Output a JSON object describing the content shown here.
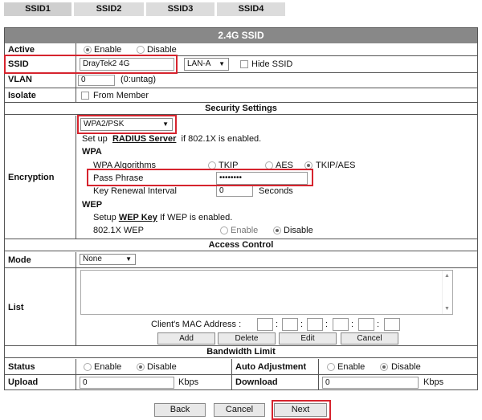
{
  "tabs": [
    "SSID1",
    "SSID2",
    "SSID3",
    "SSID4"
  ],
  "header_title": "2.4G SSID",
  "active": {
    "label": "Active",
    "enable": "Enable",
    "disable": "Disable"
  },
  "ssid": {
    "label": "SSID",
    "value": "DrayTek2 4G",
    "lan_select": "LAN-A",
    "hide_label": "Hide SSID"
  },
  "vlan": {
    "label": "VLAN",
    "value": "0",
    "hint": "(0:untag)"
  },
  "isolate": {
    "label": "Isolate",
    "option": "From Member"
  },
  "security": {
    "title": "Security Settings",
    "label": "Encryption",
    "mode_select": "WPA2/PSK",
    "setup_prefix": "Set up",
    "setup_link": "RADIUS Server",
    "setup_suffix": "if 802.1X is enabled.",
    "wpa_title": "WPA",
    "wpa_algorithms": "WPA Algorithms",
    "alg_tkip": "TKIP",
    "alg_aes": "AES",
    "alg_tkip_aes": "TKIP/AES",
    "pass_phrase_label": "Pass Phrase",
    "pass_phrase_value": "••••••••",
    "key_renewal_label": "Key Renewal Interval",
    "key_renewal_value": "0",
    "seconds": "Seconds",
    "wep_title": "WEP",
    "wep_setup_prefix": "Setup",
    "wep_setup_link": "WEP Key",
    "wep_setup_suffix": "If WEP is enabled.",
    "wep_8021x": "802.1X WEP",
    "wep_enable": "Enable",
    "wep_disable": "Disable"
  },
  "access": {
    "title": "Access Control",
    "mode_label": "Mode",
    "mode_value": "None",
    "list_label": "List",
    "mac_label": "Client's MAC Address :",
    "buttons": {
      "add": "Add",
      "delete": "Delete",
      "edit": "Edit",
      "cancel": "Cancel"
    }
  },
  "bandwidth": {
    "title": "Bandwidth Limit",
    "status_label": "Status",
    "status_enable": "Enable",
    "status_disable": "Disable",
    "auto_label": "Auto Adjustment",
    "auto_enable": "Enable",
    "auto_disable": "Disable",
    "upload_label": "Upload",
    "upload_value": "0",
    "upload_unit": "Kbps",
    "download_label": "Download",
    "download_value": "0",
    "download_unit": "Kbps"
  },
  "footer": {
    "back": "Back",
    "cancel": "Cancel",
    "next": "Next"
  },
  "colors": {
    "highlight": "#d6242e",
    "header_bg": "#888888",
    "tab_bg": "#dcdcdc"
  }
}
